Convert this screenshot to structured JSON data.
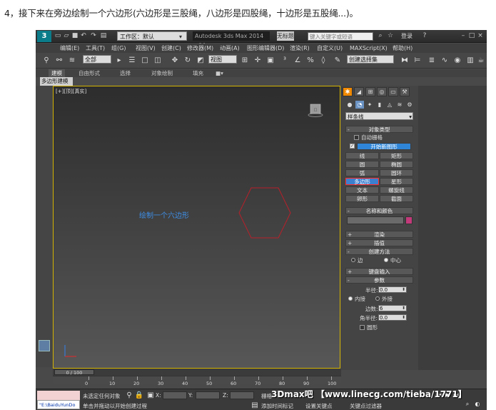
{
  "instruction": "4，接下来在旁边绘制一个六边形(六边形是三股绳，八边形是四股绳，十边形是五股绳...)。",
  "titlebar": {
    "logo": "3",
    "workspace_label": "工作区：默认",
    "app_title": "Autodesk 3ds Max  2014 x64",
    "untitled": "无标题",
    "search_placeholder": "键入关键字或短语",
    "login": "登录"
  },
  "menubar": [
    "编辑(E)",
    "工具(T)",
    "组(G)",
    "视图(V)",
    "创建(C)",
    "修改器(M)",
    "动画(A)",
    "图形编辑器(D)",
    "渲染(R)",
    "自定义(U)",
    "MAXScript(X)",
    "帮助(H)"
  ],
  "toolbar": {
    "filter": "全部",
    "view": "视图",
    "selection_set": "创建选择集"
  },
  "ribbon": {
    "tabs": [
      "建模",
      "自由形式",
      "选择",
      "对象绘制",
      "填充"
    ],
    "subtab": "多边形建模"
  },
  "viewport": {
    "label": "[+][顶][真实]",
    "annotation": "绘制一个六边形"
  },
  "command_panel": {
    "dropdown": "样条线",
    "object_type": {
      "title": "对象类型",
      "auto_grid": "自动栅格",
      "start_new_shape": "开始新图形",
      "buttons": [
        [
          "线",
          "矩形"
        ],
        [
          "圆",
          "椭圆"
        ],
        [
          "弧",
          "圆环"
        ],
        [
          "多边形",
          "星形"
        ],
        [
          "文本",
          "螺旋线"
        ],
        [
          "卵形",
          "截面"
        ]
      ]
    },
    "name_color": "名称和颜色",
    "render": "渲染",
    "interpolation": "插值",
    "creation_method": {
      "title": "创建方法",
      "edge": "边",
      "center": "中心"
    },
    "keyboard_input": "键盘输入",
    "params": {
      "title": "参数",
      "radius_label": "半径:",
      "radius_value": "0.0",
      "inscribed": "内接",
      "circumscribed": "外接",
      "sides_label": "边数:",
      "sides_value": "6",
      "corner_label": "角半径:",
      "corner_value": "0.0",
      "circular": "圆形"
    }
  },
  "timeline": {
    "slider": "0 / 100",
    "ticks": [
      "0",
      "10",
      "20",
      "30",
      "40",
      "50",
      "60",
      "70",
      "80",
      "90",
      "100"
    ]
  },
  "status": {
    "maxscript": "\"E:\\BaiduYunDo",
    "none_selected": "未选定任何对象",
    "prompt": "单击并拖动以开始创建过程",
    "x": "X:",
    "y": "Y:",
    "z": "Z:",
    "grid": "栅格",
    "add_time_tag": "添加时间标记",
    "set_key": "设置关键点",
    "key_filters": "关键点过滤器"
  },
  "watermark": "3Dmax吧 【www.linecg.com/tieba/1771】"
}
